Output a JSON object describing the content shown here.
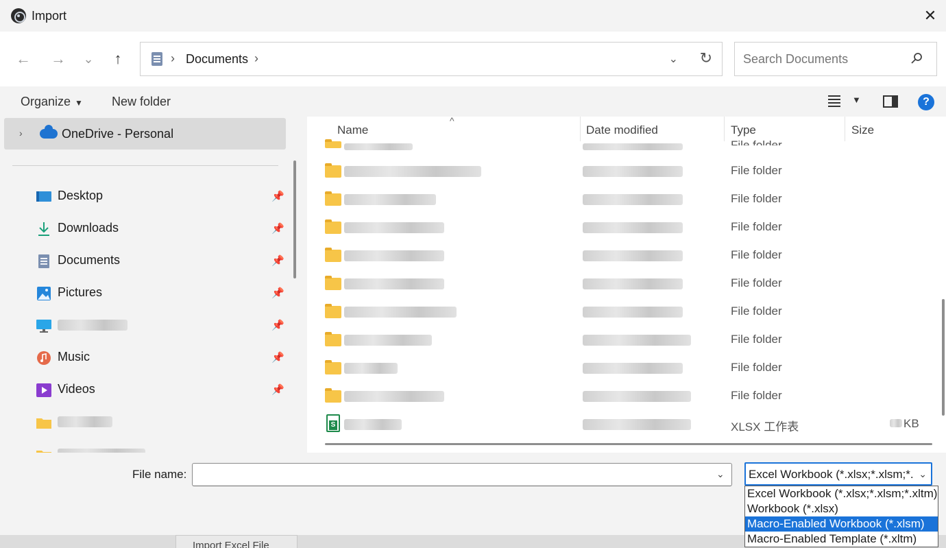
{
  "window": {
    "title": "Import",
    "close_glyph": "✕"
  },
  "nav": {
    "back_glyph": "←",
    "forward_glyph": "→",
    "recent_glyph": "⌄",
    "up_glyph": "↑",
    "address_sep": "›",
    "address_path": "Documents",
    "address_chevron": "⌄",
    "refresh_glyph": "↻",
    "search_placeholder": "Search Documents"
  },
  "commands": {
    "organize": "Organize",
    "organize_arrow": "▼",
    "new_folder": "New folder",
    "view_caret": "▼",
    "help": "?"
  },
  "sidebar": {
    "chevron": "›",
    "selected": "OneDrive - Personal",
    "pin_glyph": "📌",
    "items": [
      {
        "label": "Desktop",
        "icon": "desktop-icon",
        "pinned": true
      },
      {
        "label": "Downloads",
        "icon": "downloads-icon",
        "pinned": true
      },
      {
        "label": "Documents",
        "icon": "documents-icon",
        "pinned": true
      },
      {
        "label": "Pictures",
        "icon": "pictures-icon",
        "pinned": true
      },
      {
        "label": "",
        "icon": "monitor-icon",
        "pinned": true
      },
      {
        "label": "Music",
        "icon": "music-icon",
        "pinned": true
      },
      {
        "label": "Videos",
        "icon": "videos-icon",
        "pinned": true
      },
      {
        "label": "",
        "icon": "folder-icon",
        "pinned": false
      },
      {
        "label": "",
        "icon": "folder-icon",
        "pinned": false
      }
    ]
  },
  "filelist": {
    "sort_caret": "^",
    "columns": [
      "Name",
      "Date modified",
      "Type",
      "Size"
    ],
    "rows": [
      {
        "type": "File folder",
        "size": ""
      },
      {
        "type": "File folder",
        "size": ""
      },
      {
        "type": "File folder",
        "size": ""
      },
      {
        "type": "File folder",
        "size": ""
      },
      {
        "type": "File folder",
        "size": ""
      },
      {
        "type": "File folder",
        "size": ""
      },
      {
        "type": "File folder",
        "size": ""
      },
      {
        "type": "File folder",
        "size": ""
      },
      {
        "type": "File folder",
        "size": ""
      },
      {
        "type": "File folder",
        "size": ""
      },
      {
        "type": "File folder",
        "size": ""
      },
      {
        "type": "XLSX 工作表",
        "size": "KB"
      }
    ]
  },
  "bottom": {
    "file_name_label": "File name:",
    "file_name_value": "",
    "file_name_caret": "⌄",
    "filter_selected": "Excel Workbook (*.xlsx;*.xlsm;*.:",
    "filter_caret": "⌄",
    "filter_options": [
      {
        "label": "Excel Workbook (*.xlsx;*.xlsm;*.xltm)",
        "selected": false
      },
      {
        "label": "Workbook (*.xlsx)",
        "selected": false
      },
      {
        "label": "Macro-Enabled Workbook (*.xlsm)",
        "selected": true
      },
      {
        "label": "Macro-Enabled Template (*.xltm)",
        "selected": false
      }
    ]
  },
  "background_tab": "Import Excel File",
  "colors": {
    "accent": "#1a73d9",
    "folder": "#f7c548",
    "excel_green": "#1e8a4b"
  }
}
